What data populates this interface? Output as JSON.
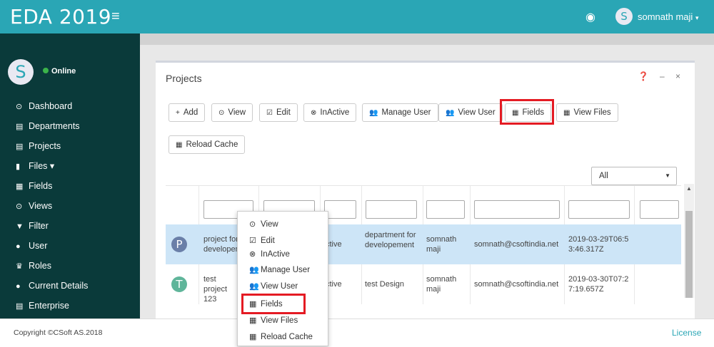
{
  "header": {
    "brand": "EDA 2019",
    "menu_icon": "≡",
    "eye_icon": "◉",
    "user_initial": "S",
    "user_name": "somnath maji",
    "caret": "▾"
  },
  "sidebar": {
    "avatar_initial": "S",
    "status": "Online",
    "items": [
      {
        "icon": "⊙",
        "label": "Dashboard"
      },
      {
        "icon": "▤",
        "label": "Departments"
      },
      {
        "icon": "▤",
        "label": "Projects"
      },
      {
        "icon": "▮",
        "label": "Files ▾"
      },
      {
        "icon": "▦",
        "label": "Fields"
      },
      {
        "icon": "⊙",
        "label": "Views"
      },
      {
        "icon": "▼",
        "label": "Filter"
      },
      {
        "icon": "●",
        "label": "User"
      },
      {
        "icon": "♛",
        "label": "Roles"
      },
      {
        "icon": "●",
        "label": "Current Details"
      },
      {
        "icon": "▤",
        "label": "Enterprise"
      }
    ]
  },
  "panel": {
    "title": "Projects",
    "tools": "❓ – ×"
  },
  "toolbar": {
    "add": {
      "icon": "+",
      "label": "Add"
    },
    "view": {
      "icon": "⊙",
      "label": "View"
    },
    "edit": {
      "icon": "☑",
      "label": "Edit"
    },
    "inactive": {
      "icon": "⊗",
      "label": "InActive"
    },
    "manage_user": {
      "icon": "👥",
      "label": "Manage User"
    },
    "view_user": {
      "icon": "👥",
      "label": "View User"
    },
    "fields": {
      "icon": "▦",
      "label": "Fields"
    },
    "view_files": {
      "icon": "▦",
      "label": "View Files"
    },
    "reload_cache": {
      "icon": "▦",
      "label": "Reload Cache"
    }
  },
  "filter_select": {
    "value": "All",
    "arrow": "▼"
  },
  "table": {
    "rows": [
      {
        "initial": "P",
        "avatar_color": "#6a7fa8",
        "name": "project for developem",
        "status": "ctive",
        "department": "department for developement",
        "user": "somnath maji",
        "email": "somnath@csoftindia.net",
        "date": "2019-03-29T06:53:46.317Z"
      },
      {
        "initial": "T",
        "avatar_color": "#5fb59a",
        "name": "test project 123",
        "status": "ctive",
        "department": "test Design",
        "user": "somnath maji",
        "email": "somnath@csoftindia.net",
        "date": "2019-03-30T07:27:19.657Z"
      }
    ]
  },
  "context_menu": {
    "items": [
      {
        "icon": "⊙",
        "label": "View"
      },
      {
        "icon": "☑",
        "label": "Edit"
      },
      {
        "icon": "⊗",
        "label": "InActive"
      },
      {
        "icon": "👥",
        "label": "Manage User"
      },
      {
        "icon": "👥",
        "label": "View User"
      },
      {
        "icon": "▦",
        "label": "Fields"
      },
      {
        "icon": "▦",
        "label": "View Files"
      },
      {
        "icon": "▦",
        "label": "Reload Cache"
      }
    ]
  },
  "footer": {
    "copyright": "Copyright ©CSoft AS.2018",
    "license": "License"
  },
  "colors": {
    "header": "#2aa6b5",
    "sidebar": "#0a3a3a",
    "highlight": "#e41b23",
    "selected_row": "#cde5f7"
  }
}
